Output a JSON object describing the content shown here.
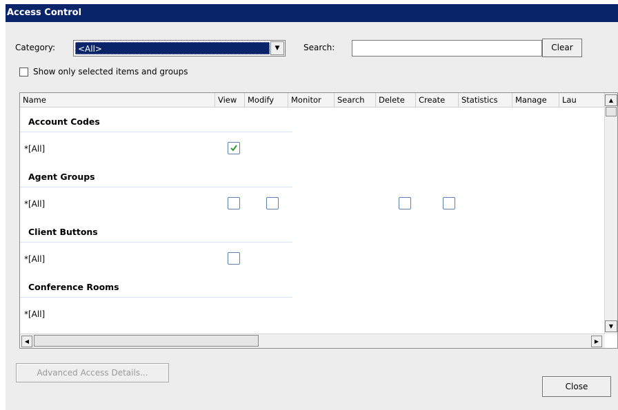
{
  "window": {
    "title": "Access Control"
  },
  "filters": {
    "category_label": "Category:",
    "category_value": "<All>",
    "search_label": "Search:",
    "search_value": "",
    "clear_label": "Clear",
    "show_selected_label": "Show only selected items and groups",
    "show_selected_checked": false
  },
  "grid": {
    "columns": [
      "Name",
      "View",
      "Modify",
      "Monitor",
      "Search",
      "Delete",
      "Create",
      "Statistics",
      "Manage",
      "Lau"
    ],
    "groups": [
      {
        "title": "Account Codes",
        "row": "*[All]",
        "view": "checked",
        "modify": "none",
        "delete": "none",
        "create": "none"
      },
      {
        "title": "Agent Groups",
        "row": "*[All]",
        "view": "unchecked",
        "modify": "unchecked",
        "delete": "unchecked",
        "create": "unchecked"
      },
      {
        "title": "Client Buttons",
        "row": "*[All]",
        "view": "unchecked",
        "modify": "none",
        "delete": "none",
        "create": "none"
      },
      {
        "title": "Conference Rooms",
        "row": "*[All]",
        "view": "none",
        "modify": "none",
        "delete": "none",
        "create": "none"
      }
    ]
  },
  "footer": {
    "advanced_label": "Advanced Access Details...",
    "close_label": "Close"
  },
  "icons": {
    "scroll_up": "arrow-up-icon",
    "scroll_down": "arrow-down-icon",
    "scroll_left": "arrow-left-icon",
    "scroll_right": "arrow-right-icon",
    "checkmark": "checkmark-icon"
  },
  "colors": {
    "titlebar": "#0a246a",
    "selection": "#0a246a",
    "checkmark": "#2e9a2e",
    "checkbox_border": "#5b7faf"
  }
}
